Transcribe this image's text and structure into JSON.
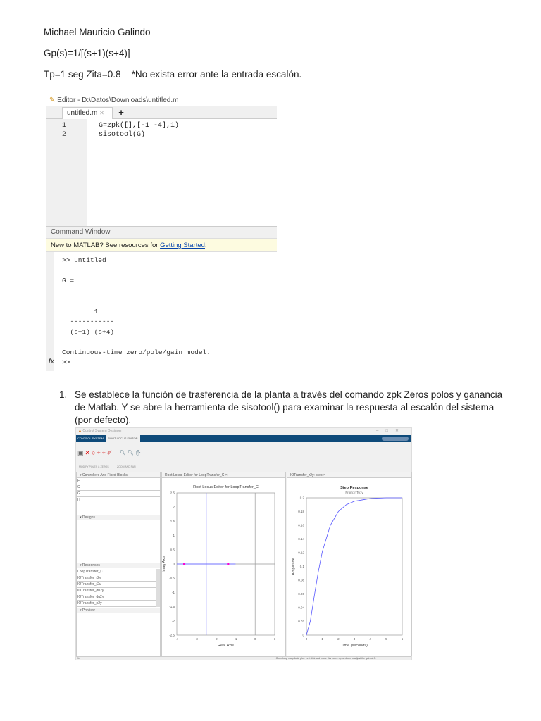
{
  "doc": {
    "author": "Michael Mauricio Galindo",
    "plant": "Gp(s)=1/[(s+1)(s+4)]",
    "specs": "Tp=1 seg Zita=0.8    *No exista error ante la entrada escalón.",
    "list_number": "1.",
    "list_text": "Se establece la función de trasferencia de la planta a través del comando zpk Zeros polos y ganancia de Matlab. Y se abre la herramienta de sisotool() para examinar la respuesta al escalón del sistema (por defecto)."
  },
  "editor": {
    "title": "Editor - D:\\Datos\\Downloads\\untitled.m",
    "tab": "untitled.m",
    "tab_close": "✕",
    "tab_add": "+",
    "lines": [
      {
        "n": "1",
        "code": "G=zpk([],[-1 -4],1)"
      },
      {
        "n": "2",
        "code": "sisotool(G)"
      }
    ]
  },
  "command_window": {
    "title": "Command Window",
    "notice": "New to MATLAB? See resources for ",
    "notice_link": "Getting Started",
    "notice_end": ".",
    "output": [
      ">> untitled",
      "",
      "G =",
      "",
      "",
      "        1",
      "  -----------",
      "  (s+1) (s+4)",
      "",
      "Continuous-time zero/pole/gain model.",
      ""
    ],
    "prompt_icon": "fx",
    "prompt": ">>"
  },
  "sisotool": {
    "title": "Control System Designer",
    "tabs": [
      "CONTROL SYSTEM",
      "ROOT LOCUS EDITOR"
    ],
    "sections": [
      "MODIFY POLES & ZEROS",
      "ZOOM AND PAN"
    ],
    "controllers_header": "Controllers And Fixed Blocks",
    "controllers": [
      "F",
      "C",
      "G",
      "H"
    ],
    "designs_header": "Designs",
    "responses_header": "Responses",
    "responses": [
      "LoopTransfer_C",
      "IOTransfer_r2y",
      "IOTransfer_r2u",
      "IOTransfer_du2y",
      "IOTransfer_du2y",
      "IOTransfer_n2y"
    ],
    "preview_header": "Preview",
    "rl_tab": "Root Locus Editor for LoopTransfer_C  ×",
    "step_tab": "IOTransfer_r2y: step  ×",
    "status": "Open-loop magnitude plot. Left click and move this curve up or down to adjust the gain of C.",
    "status_left": "14"
  },
  "chart_data": [
    {
      "type": "scatter",
      "title": "Root Locus Editor for LoopTransfer_C",
      "xlabel": "Real Axis",
      "ylabel": "Imag Axis",
      "xlim": [
        -4,
        1
      ],
      "ylim": [
        -2.5,
        2.5
      ],
      "xticks": [
        "-4",
        "-3",
        "-2",
        "-1",
        "0",
        "1"
      ],
      "yticks": [
        "-2.5",
        "-2",
        "-1.5",
        "-1",
        "-0.5",
        "0",
        "0.5",
        "1",
        "1.5",
        "2",
        "2.5"
      ],
      "closed_loop_poles": [
        [
          -3.62,
          0
        ],
        [
          -1.38,
          0
        ]
      ],
      "locus_real_segment": [
        -4,
        -1
      ],
      "locus_vertical_at": -2.5,
      "color": "#7070ff",
      "pole_color": "#ff00cc"
    },
    {
      "type": "line",
      "title": "Step Response",
      "subtitle": "From: r  To: y",
      "xlabel": "Time (seconds)",
      "ylabel": "Amplitude",
      "xlim": [
        0,
        6
      ],
      "ylim": [
        0,
        0.2
      ],
      "xticks": [
        "0",
        "1",
        "2",
        "3",
        "4",
        "5",
        "6"
      ],
      "yticks": [
        "0",
        "0.02",
        "0.04",
        "0.06",
        "0.08",
        "0.1",
        "0.12",
        "0.14",
        "0.16",
        "0.18",
        "0.2"
      ],
      "x": [
        0,
        0.25,
        0.5,
        0.75,
        1,
        1.5,
        2,
        2.5,
        3,
        3.5,
        4,
        5,
        6
      ],
      "y": [
        0,
        0.021,
        0.058,
        0.093,
        0.122,
        0.16,
        0.18,
        0.19,
        0.195,
        0.197,
        0.199,
        0.2,
        0.2
      ],
      "color": "#5555ff"
    }
  ]
}
